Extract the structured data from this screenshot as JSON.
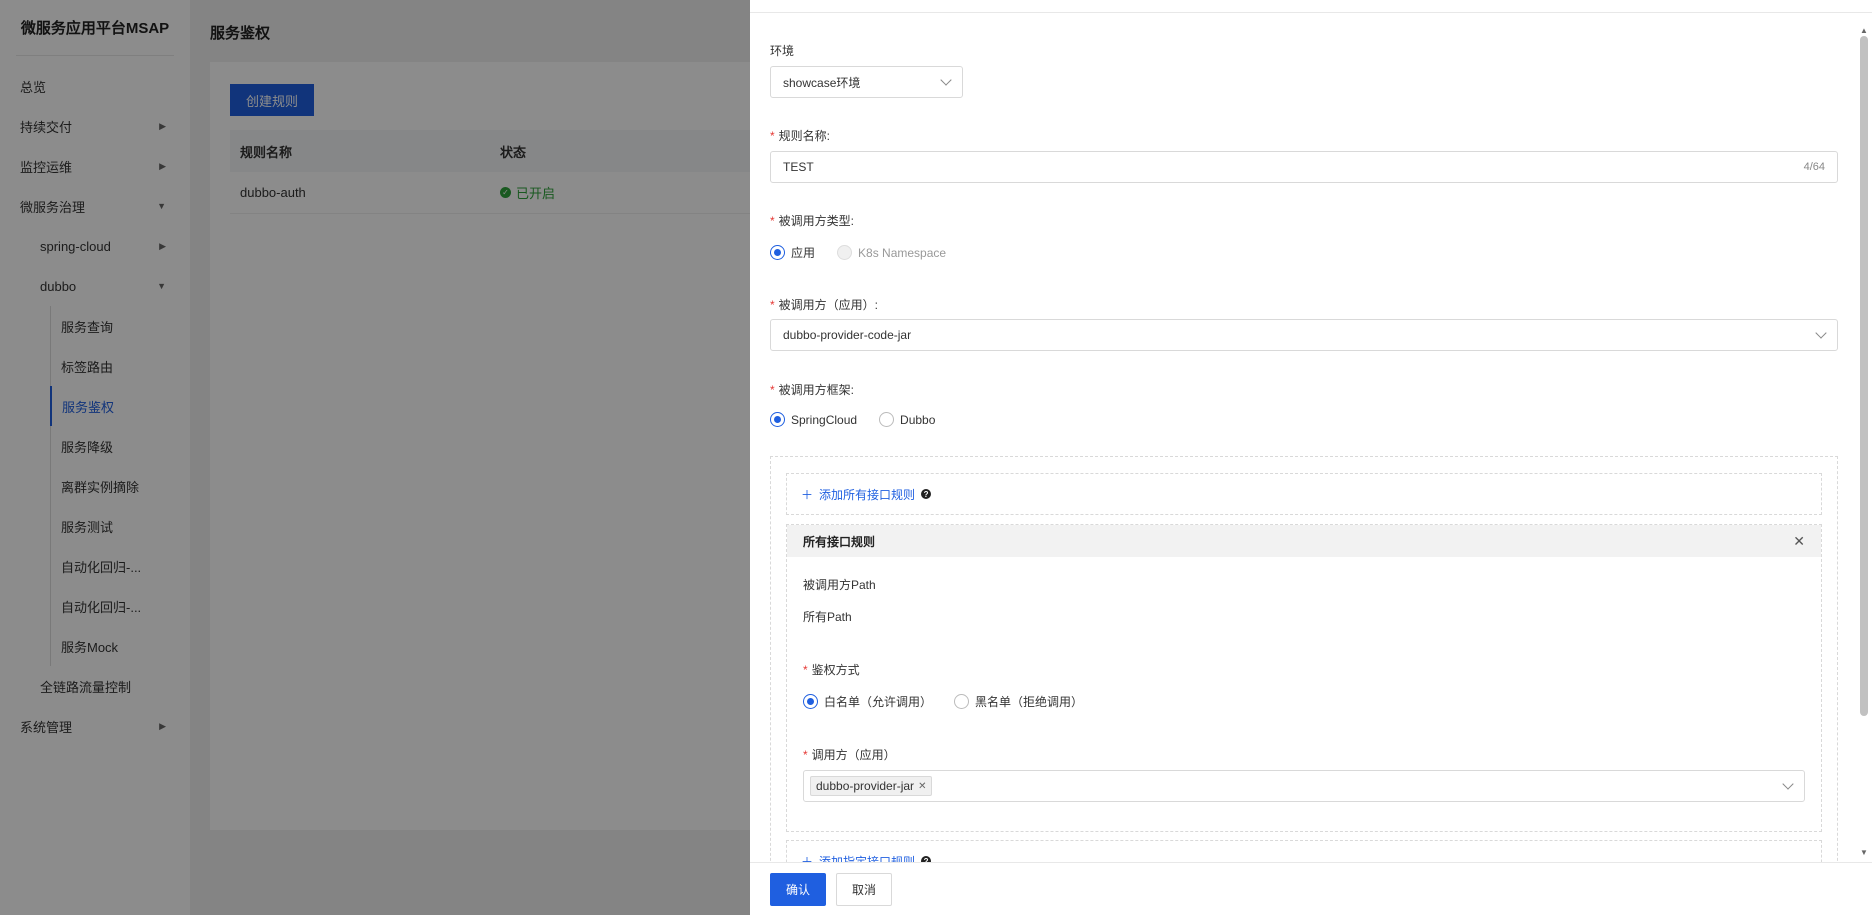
{
  "sidebar": {
    "brand": "微服务应用平台MSAP",
    "items": {
      "overview": "总览",
      "delivery": "持续交付",
      "monitor": "监控运维",
      "governance": "微服务治理",
      "spring_cloud": "spring-cloud",
      "dubbo": "dubbo",
      "service_query": "服务查询",
      "tag_route": "标签路由",
      "service_auth": "服务鉴权",
      "service_degrade": "服务降级",
      "outlier": "离群实例摘除",
      "service_test": "服务测试",
      "auto_regress_1": "自动化回归-...",
      "auto_regress_2": "自动化回归-...",
      "service_mock": "服务Mock",
      "full_link": "全链路流量控制",
      "system": "系统管理"
    }
  },
  "main": {
    "title": "服务鉴权",
    "create_button": "创建规则",
    "table": {
      "headers": [
        "规则名称",
        "状态"
      ],
      "rows": [
        {
          "name": "dubbo-auth",
          "status": "已开启"
        }
      ]
    }
  },
  "drawer": {
    "env_label": "环境",
    "env_value": "showcase环境",
    "rule_name_label": "规则名称:",
    "rule_name_value": "TEST",
    "rule_name_counter": "4/64",
    "callee_type_label": "被调用方类型:",
    "callee_type_opt1": "应用",
    "callee_type_opt2": "K8s Namespace",
    "callee_label": "被调用方（应用）:",
    "callee_value": "dubbo-provider-code-jar",
    "framework_label": "被调用方框架:",
    "framework_opt1": "SpringCloud",
    "framework_opt2": "Dubbo",
    "add_all_rule": "添加所有接口规则",
    "all_rule_title": "所有接口规则",
    "path_label": "被调用方Path",
    "path_value": "所有Path",
    "auth_mode_label": "鉴权方式",
    "auth_whitelist": "白名单（允许调用）",
    "auth_blacklist": "黑名单（拒绝调用）",
    "caller_label": "调用方（应用）",
    "caller_tag": "dubbo-provider-jar",
    "add_specific_rule": "添加指定接口规则",
    "confirm": "确认",
    "cancel": "取消"
  },
  "colors": {
    "primary": "#1f5fe0",
    "success": "#2fa33b",
    "required": "#e53935"
  }
}
